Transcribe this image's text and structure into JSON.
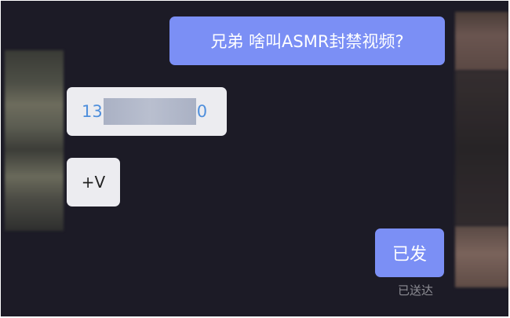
{
  "messages": [
    {
      "id": "m1",
      "direction": "sent",
      "text": "兄弟 啥叫ASMR封禁视频?"
    },
    {
      "id": "m2",
      "direction": "received",
      "phone_start": "13",
      "phone_end": "0"
    },
    {
      "id": "m3",
      "direction": "received",
      "text": "+V"
    },
    {
      "id": "m4",
      "direction": "sent",
      "text": "已发"
    }
  ],
  "status": {
    "delivered": "已送达"
  },
  "colors": {
    "background": "#1c1b26",
    "sent_bubble": "#7b8ff5",
    "received_bubble": "#ececf0",
    "link": "#4f8fdc"
  }
}
